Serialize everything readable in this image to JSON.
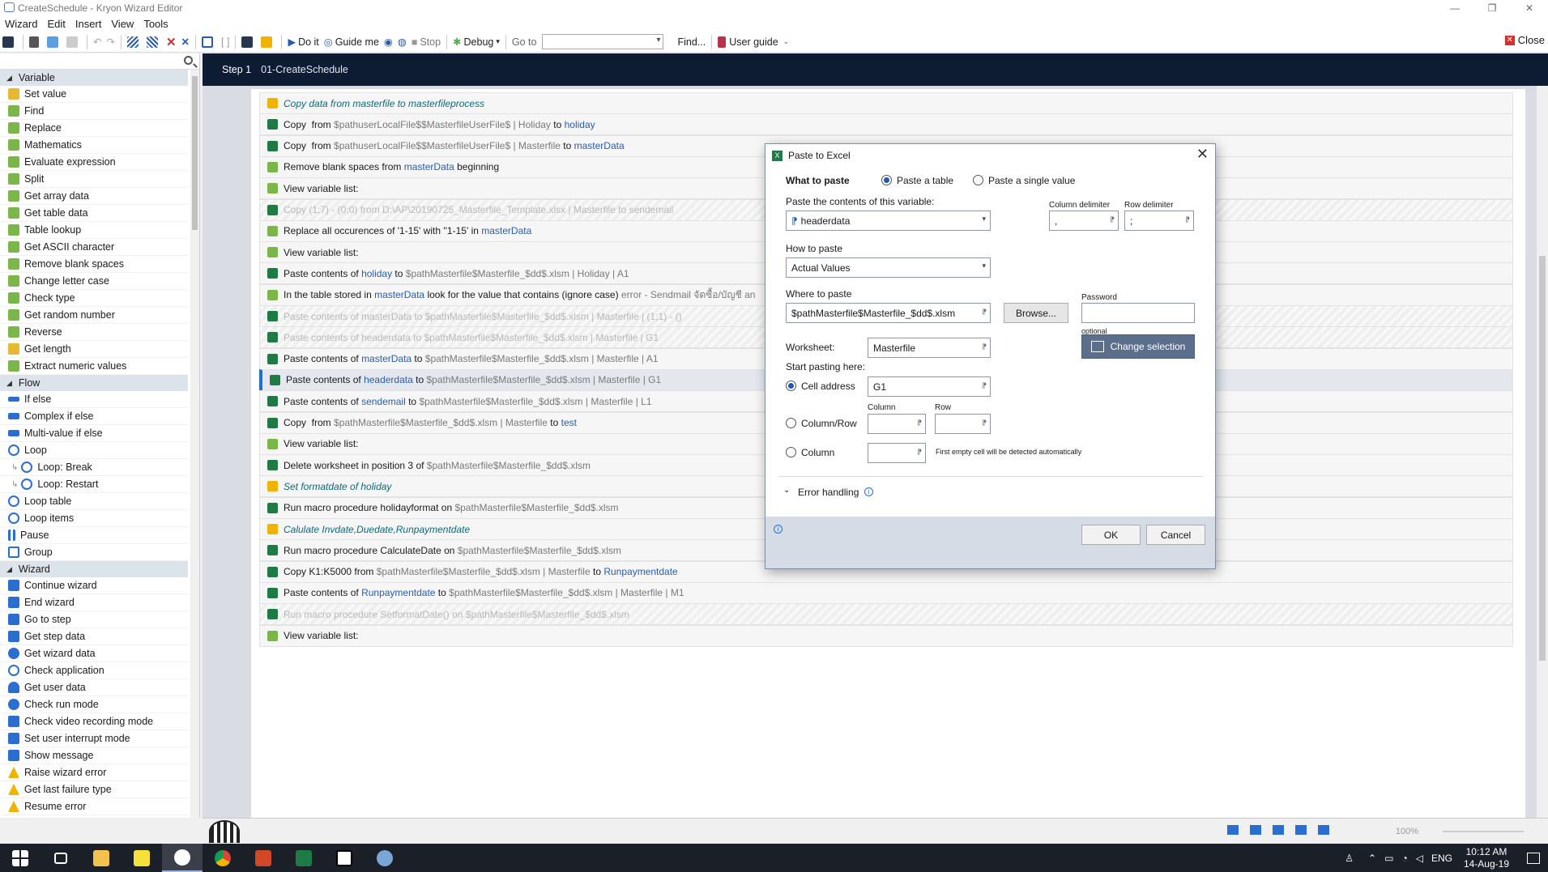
{
  "window": {
    "title": "CreateSchedule - Kryon Wizard Editor",
    "close_label": "Close"
  },
  "menu": [
    "Wizard",
    "Edit",
    "Insert",
    "View",
    "Tools"
  ],
  "toolbar": {
    "do_it": "Do it",
    "guide_me": "Guide me",
    "stop": "Stop",
    "debug": "Debug",
    "go_to": "Go to",
    "find": "Find...",
    "user_guide": "User guide"
  },
  "sidebar": {
    "categories": {
      "variable": "Variable",
      "flow": "Flow",
      "wizard": "Wizard"
    },
    "variable_items": [
      "Set value",
      "Find",
      "Replace",
      "Mathematics",
      "Evaluate expression",
      "Split",
      "Get array data",
      "Get table data",
      "Table lookup",
      "Get ASCII character",
      "Remove blank spaces",
      "Change letter case",
      "Check type",
      "Get random number",
      "Reverse",
      "Get length",
      "Extract numeric values"
    ],
    "flow_items": [
      "If else",
      "Complex if else",
      "Multi-value if else",
      "Loop",
      "Loop: Break",
      "Loop: Restart",
      "Loop table",
      "Loop items",
      "Pause",
      "Group"
    ],
    "wizard_items": [
      "Continue wizard",
      "End wizard",
      "Go to step",
      "Get step data",
      "Get wizard data",
      "Check application",
      "Get user data",
      "Check run mode",
      "Check video recording mode",
      "Set user interrupt mode",
      "Show message",
      "Raise wizard error",
      "Get last failure type",
      "Resume error"
    ]
  },
  "step": {
    "label": "Step 1",
    "name": "01-CreateSchedule"
  },
  "rows": [
    {
      "t": "Copy data from masterfile to masterfileprocess"
    },
    {
      "a": "Copy  from ",
      "b": "$pathuserLocalFile$$MasterfileUserFile$",
      "c": " | Holiday ",
      "d": "to ",
      "e": "holiday"
    },
    {
      "a": "Copy  from ",
      "b": "$pathuserLocalFile$$MasterfileUserFile$",
      "c": " | Masterfile ",
      "d": "to ",
      "e": "masterData"
    },
    {
      "a": "Remove blank spaces from ",
      "e": "masterData",
      "f": " beginning"
    },
    {
      "a": "View variable list:"
    },
    {
      "a": "Copy (1;7) - (0;0) from D:\\AP\\20190725_Masterfile_Template.xlsx | Masterfile to sendemail"
    },
    {
      "a": "Replace all occurences of '1-15' with ''1-15' in ",
      "e": "masterData"
    },
    {
      "a": "View variable list:"
    },
    {
      "a": "Paste contents of ",
      "e": "holiday",
      "f": " to ",
      "b": "$pathMasterfile$Masterfile_$dd$.xlsm",
      "c": " | Holiday | A1"
    },
    {
      "a": "In the table stored in ",
      "e": "masterData",
      "f": " look for the value that contains (ignore case) ",
      "b": "error - Sendmail จัดซื้อ/บัญชี an"
    },
    {
      "a": "Paste contents of masterData to $pathMasterfile$Masterfile_$dd$.xlsm | Masterfile | (1;1) - ()"
    },
    {
      "a": "Paste contents of headerdata to $pathMasterfile$Masterfile_$dd$.xlsm | Masterfile | G1"
    },
    {
      "a": "Paste contents of ",
      "e": "masterData",
      "f": " to ",
      "b": "$pathMasterfile$Masterfile_$dd$.xlsm",
      "c": " | Masterfile | A1"
    },
    {
      "a": "Paste contents of ",
      "e": "headerdata",
      "f": " to ",
      "b": "$pathMasterfile$Masterfile_$dd$.xlsm",
      "c": " | Masterfile | G1"
    },
    {
      "a": "Paste contents of ",
      "e": "sendemail",
      "f": " to ",
      "b": "$pathMasterfile$Masterfile_$dd$.xlsm",
      "c": " | Masterfile | L1"
    },
    {
      "a": "Copy  from ",
      "b": "$pathMasterfile$Masterfile_$dd$.xlsm",
      "c": " | Masterfile ",
      "d": "to ",
      "e": "test"
    },
    {
      "a": "View variable list:"
    },
    {
      "a": "Delete worksheet in position ",
      "f": "3",
      "d": " of ",
      "b": "$pathMasterfile$Masterfile_$dd$.xlsm"
    },
    {
      "t": "Set formatdate of holiday"
    },
    {
      "a": "Run macro procedure ",
      "f": "holidayformat",
      "d": " on ",
      "b": "$pathMasterfile$Masterfile_$dd$.xlsm"
    },
    {
      "t": "Calulate Invdate,Duedate,Runpaymentdate"
    },
    {
      "a": "Run macro procedure ",
      "f": "CalculateDate",
      "d": " on ",
      "b": "$pathMasterfile$Masterfile_$dd$.xlsm"
    },
    {
      "a": "Copy K1:K5000 from ",
      "b": "$pathMasterfile$Masterfile_$dd$.xlsm",
      "c": " | Masterfile ",
      "d": "to ",
      "e": "Runpaymentdate"
    },
    {
      "a": "Paste contents of ",
      "e": "Runpaymentdate",
      "f": " to ",
      "b": "$pathMasterfile$Masterfile_$dd$.xlsm",
      "c": " | Masterfile | M1"
    },
    {
      "a": "Run macro procedure SetformatDate() on $pathMasterfile$Masterfile_$dd$.xlsm"
    },
    {
      "a": "View variable list:"
    }
  ],
  "status": {
    "zoom": "100%"
  },
  "taskbar": {
    "lang": "ENG",
    "time": "10:12 AM",
    "date": "14-Aug-19"
  },
  "dialog": {
    "title": "Paste to Excel",
    "what_to_paste": "What to paste",
    "opt_table": "Paste a table",
    "opt_single": "Paste a single value",
    "contents_label": "Paste the contents of this variable:",
    "contents_value": "headerdata",
    "col_delim_label": "Column delimiter",
    "col_delim_value": ",",
    "row_delim_label": "Row delimiter",
    "row_delim_value": ";",
    "how_label": "How to paste",
    "how_value": "Actual Values",
    "where_label": "Where to paste",
    "where_value": "$pathMasterfile$Masterfile_$dd$.xlsm",
    "browse": "Browse...",
    "password_label": "Password",
    "optional": "optional",
    "worksheet_label": "Worksheet:",
    "worksheet_value": "Masterfile",
    "change_selection": "Change selection",
    "start_label": "Start pasting here:",
    "cell_address": "Cell address",
    "cell_value": "G1",
    "column_row": "Column/Row",
    "col_hdr": "Column",
    "row_hdr": "Row",
    "column": "Column",
    "auto_note": "First empty cell will be detected automatically",
    "error_handling": "Error handling",
    "ok": "OK",
    "cancel": "Cancel"
  }
}
